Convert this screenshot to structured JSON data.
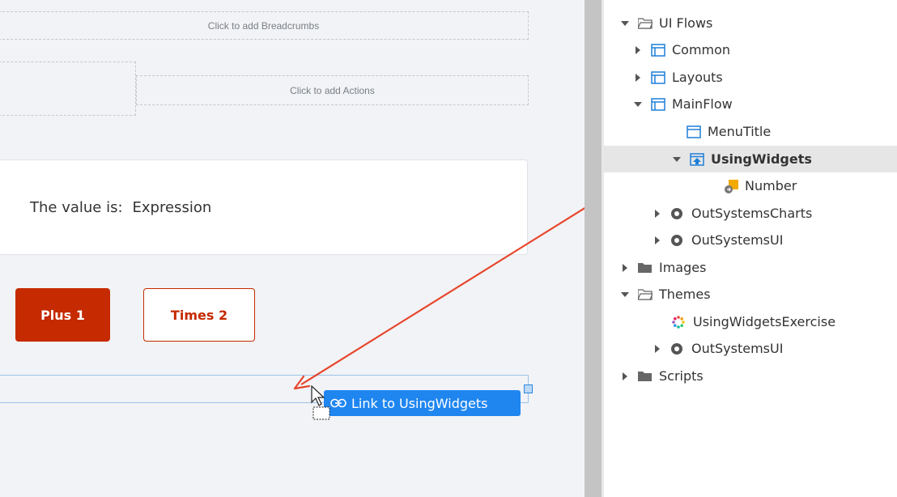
{
  "canvas": {
    "breadcrumbs_placeholder": "Click to add Breadcrumbs",
    "actions_placeholder": "Click to add Actions",
    "value_label": "The value is:",
    "value_expression": "Expression",
    "plus_button": "Plus 1",
    "times_button": "Times 2",
    "link_tooltip": "Link to UsingWidgets"
  },
  "tree": {
    "items": [
      {
        "label": "UI Flows"
      },
      {
        "label": "Common"
      },
      {
        "label": "Layouts"
      },
      {
        "label": "MainFlow"
      },
      {
        "label": "MenuTitle"
      },
      {
        "label": "UsingWidgets"
      },
      {
        "label": "Number"
      },
      {
        "label": "OutSystemsCharts"
      },
      {
        "label": "OutSystemsUI"
      },
      {
        "label": "Images"
      },
      {
        "label": "Themes"
      },
      {
        "label": "UsingWidgetsExercise"
      },
      {
        "label": "OutSystemsUI"
      },
      {
        "label": "Scripts"
      }
    ]
  },
  "colors": {
    "primary_button": "#c52a00",
    "link_tooltip": "#1f86f0",
    "annotation_arrow": "#e8452c",
    "screen_icon": "#1e7fd8"
  }
}
